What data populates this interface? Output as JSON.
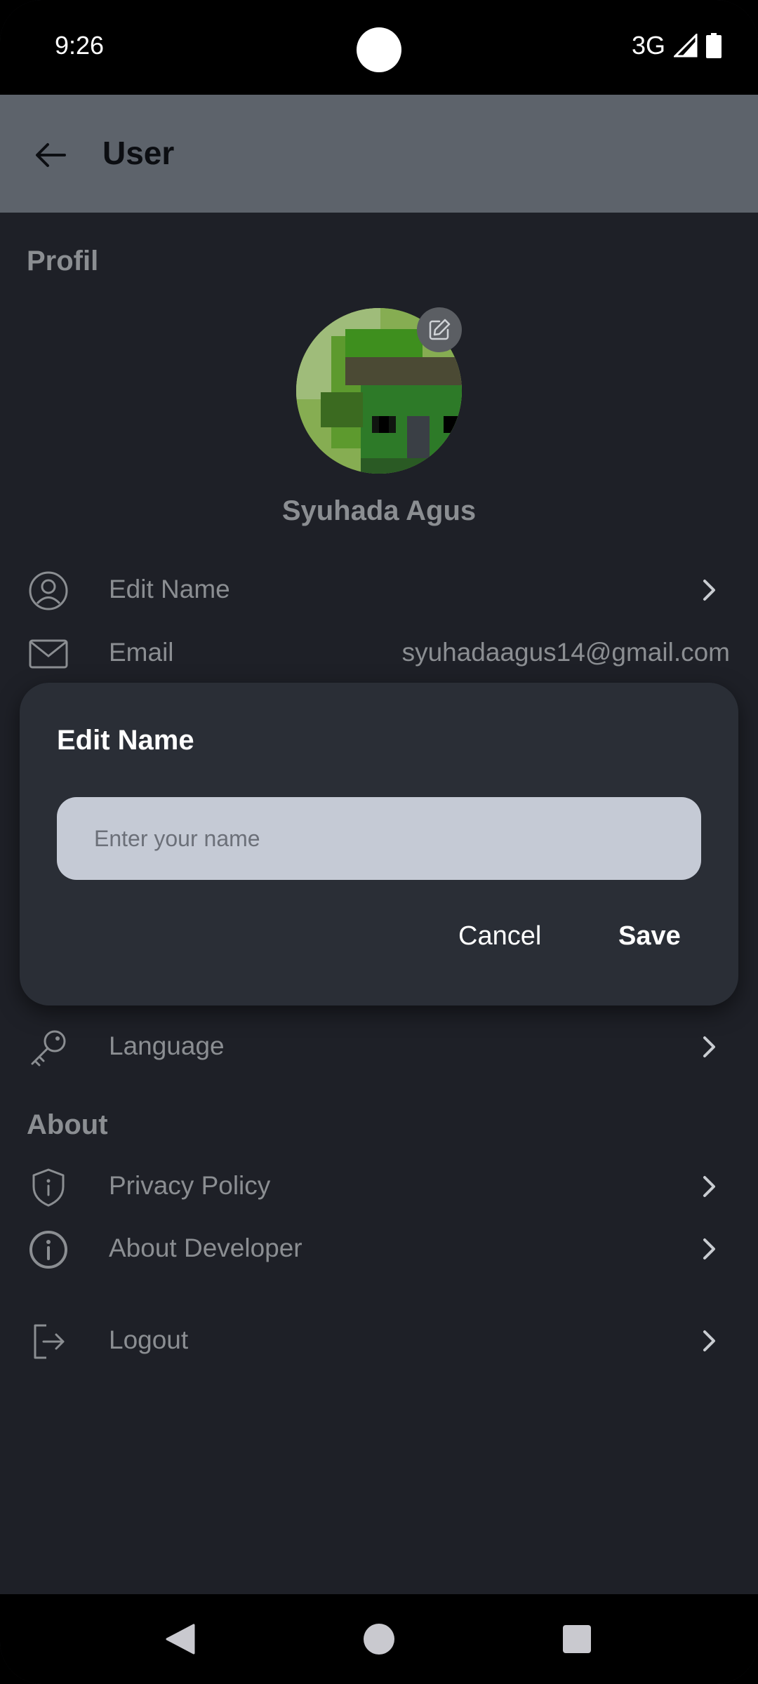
{
  "status_bar": {
    "time": "9:26",
    "network": "3G"
  },
  "app_bar": {
    "title": "User",
    "back_icon": "arrow-left-icon"
  },
  "profile": {
    "section_title": "Profil",
    "name": "Syuhada Agus",
    "rows": [
      {
        "label": "Edit Name",
        "icon": "user-circle-icon"
      },
      {
        "label": "Email",
        "icon": "mail-icon",
        "value": "syuhadaagus14@gmail.com"
      },
      {
        "label": "Language",
        "icon": "key-icon"
      }
    ]
  },
  "about": {
    "section_title": "About",
    "rows": [
      {
        "label": "Privacy Policy",
        "icon": "shield-info-icon"
      },
      {
        "label": "About Developer",
        "icon": "info-icon"
      },
      {
        "label": "Logout",
        "icon": "logout-icon"
      }
    ]
  },
  "dialog": {
    "title": "Edit Name",
    "input_placeholder": "Enter your name",
    "input_value": "",
    "cancel_label": "Cancel",
    "save_label": "Save"
  },
  "colors": {
    "background": "#1e2027",
    "app_bar": "#5d636b",
    "dialog": "#2a2e36",
    "input": "#c5cad5",
    "muted_text": "#8b8e92"
  }
}
